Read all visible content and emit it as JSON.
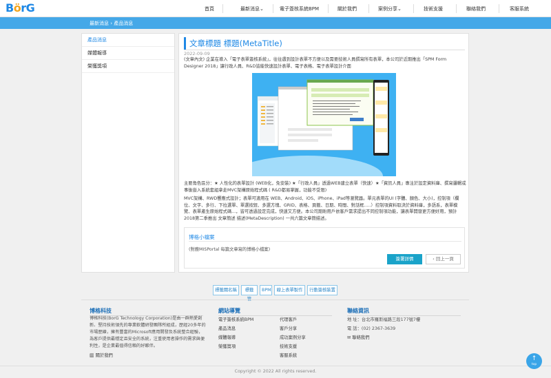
{
  "header": {
    "logo": {
      "b": "B",
      "o": "ö",
      "rg": "rG"
    },
    "nav": [
      {
        "label": "首頁"
      },
      {
        "label": "最新消息",
        "caret": "⌄"
      },
      {
        "label": "電子簽核系統BPM"
      },
      {
        "label": "關於我們"
      },
      {
        "label": "案例分享",
        "caret": "⌄"
      },
      {
        "label": "技術支援"
      },
      {
        "label": "聯絡我們"
      },
      {
        "label": "客服系統"
      }
    ]
  },
  "breadcrumb": "最新消息 › 產品消息",
  "sidebar": {
    "items": [
      {
        "label": "產品消息"
      },
      {
        "label": "媒體報導"
      },
      {
        "label": "榮獲獎項"
      }
    ]
  },
  "article": {
    "title": "文章標題 標題(MetaTitle)",
    "date": "2022-09-09",
    "para1": "(文章內文) 企業在導入「電子表單簽核系統」，往往遇到設計表單不方便以及需要技術人員撰寫所有表單，本公司於近期推出「SPM Form Designer 2018」讓行政人員、R&D皆能快速設計表單、電子表格、電子表單設計介面",
    "para2": "主要角色區分：★ 人性化的表單設計 (WEB化，免安裝) ★「行政人員」透過WEB建立表單（快速）★「資訊人員」專注於設定資料庫、撰寫邏輯或事後嵌入系統套組拿走MVC架構原始程式碼 ( R&D都易掌握，功能不受限)",
    "para3": "MVC架構、RWD響應式設計；表單可適用在 WEB、Android、iOS、iPhone、iPad等瀏覽器。單元表單的UI (字體、顏色、大小)，控制項（欄位、文字、多行、下拉選單、單選按鈕、多選方塊、GRID、表格、頁籤、日期、時間、對話框.....）控制項資料取決於資料庫，多語系，表單模覽、表單產生原始程式碼...，皆可透過設定完成，快速又方便。本公司期盼用戶依客戶需求提出不同控制項功能，讓表單開發更方便好用，預計2018第二季推出 文章簡述 描述(MetaDescription) 一共六篇文章簡描述。",
    "card": {
      "title": "博格小檔案",
      "text": "(對應MISPortal 每篇文章寫的博格小檔案)",
      "subscribe": "簽署詳情",
      "back": "‹ 回上一頁"
    }
  },
  "tags": [
    "標籤關名稱",
    "標籤管",
    "BPM",
    "線上表單製作",
    "行動簽核裝置"
  ],
  "footer": {
    "company": {
      "title": "博格科技",
      "text": "博格科技(BorG Technology Corporation)是由一群熱愛創新、堅持技術領先的專業軟體研發團隊所組成，歷經20多年的市場歷練，擁有豐富的Microsoft應用開發及系統整合經驗，為客戶提供最穩定且安全的系統，注重使用者操作的需求與便利性，是企業最值得信賴的好夥伴。",
      "about": "關於我們"
    },
    "sitemap": {
      "title": "網站導覽",
      "col1": [
        "電子簽核系統BPM",
        "產品消息",
        "媒體報導",
        "榮獲獎項"
      ],
      "col2": [
        "代理客戶",
        "客戶分享",
        "成功案例分享",
        "技術支援",
        "客服系統"
      ]
    },
    "contact": {
      "title": "聯絡資訊",
      "address": "地 址：台北市羅斯福路三段177號7樓",
      "phone": "電 話：(02) 2367-3639",
      "contact_link": "聯絡我們"
    },
    "copyright": "Copyright © 2022 All rights reserved.",
    "top": {
      "arrow": "↑",
      "label": "top"
    }
  },
  "colors": {
    "brand": "#1e88e5",
    "bar": "#45a8e8",
    "button": "#1aa3c9"
  }
}
